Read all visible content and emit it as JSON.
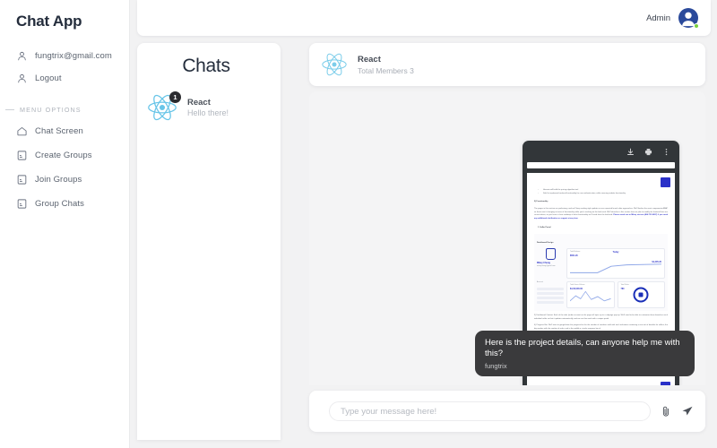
{
  "sidebar": {
    "brand": "Chat App",
    "account_items": [
      {
        "label": "fungtrix@gmail.com",
        "icon": "user-icon"
      },
      {
        "label": "Logout",
        "icon": "user-icon"
      }
    ],
    "menu_heading": "MENU OPTIONS",
    "menu_items": [
      {
        "label": "Chat Screen",
        "icon": "home-icon"
      },
      {
        "label": "Create Groups",
        "icon": "card-icon"
      },
      {
        "label": "Join Groups",
        "icon": "card-icon"
      },
      {
        "label": "Group Chats",
        "icon": "card-icon"
      }
    ]
  },
  "topbar": {
    "user_label": "Admin",
    "avatar_icon": "user-avatar",
    "status": "online",
    "status_color": "#7ad13f"
  },
  "chats_panel": {
    "title": "Chats",
    "items": [
      {
        "name": "React",
        "preview": "Hello there!",
        "unread": "1",
        "avatar_icon": "react-logo"
      }
    ]
  },
  "chat": {
    "header": {
      "name": "React",
      "members": "Total Members 3",
      "avatar_icon": "react-logo"
    },
    "attachment": {
      "type": "pdf-preview",
      "toolbar": [
        {
          "name": "download-icon"
        },
        {
          "name": "print-icon"
        },
        {
          "name": "more-options-icon"
        }
      ],
      "document": {
        "bullets": [
          "Hassain will build the pricing algorithm tool",
          "Sahil to implement backend functionality for user authentication, while ensuring website functionality."
        ],
        "section_heading": "2)  Functionality",
        "paragraph": "The pages in this section are preliminary, and we'll keep making style updates as our expected launch date approaches. We'll finalize the react components ASAP so these aren't changing in terms of functionality while you're working on the back-end. We'll describe in this section how we plan to modify the frontend from our current demo, so you have a clear roadmap of what functionality we'll need from the backend. ",
        "paragraph_bold": "Please reach out to Mikey via text (404-731-8037) if you need any additional clarification or support at any time.",
        "subsection": "1.  Seller Portal",
        "mock_title": "Dashboard Design",
        "mock_user": "Mikey Chung",
        "mock_user_mail": "mikeychung@gmail.com",
        "mock_account_label": "Account",
        "mock_menu": [
          "Dashboard",
          "Inventory",
          "Notifications",
          "Settings"
        ],
        "mock_card1_label": "Total Balance",
        "mock_card1_value": "$501.26",
        "mock_card1_title": "Today",
        "mock_card1_amount": "$1,205.20",
        "mock_card2_label": "Total Gross Volume",
        "mock_card2_value": "$1,53,000.00",
        "mock_card3_label": "Total Sales",
        "mock_card3_value": "780",
        "footer_note1": "3)  Dashboard Content. Each of the tabs (under account on the page will open up to a subpage pop-up. We'll need to be able to customize these based on each individual seller so that it updates automatically, and we can then work with a unique portal.",
        "footer_note2": "4)  Progress Bar. We'll want to gauge/show the progress bar for the number of sneakers sold with each milestone containing a new set of benefits for sellers; the big number with the number of sales, and in the middle a circular progress bar of"
      }
    },
    "messages": [
      {
        "text": "Here is the project details, can anyone help me with this?",
        "sender": "fungtrix",
        "side": "right"
      }
    ],
    "composer": {
      "placeholder": "Type your message here!",
      "value": "",
      "attach_icon": "paperclip-icon",
      "send_icon": "send-icon"
    }
  }
}
